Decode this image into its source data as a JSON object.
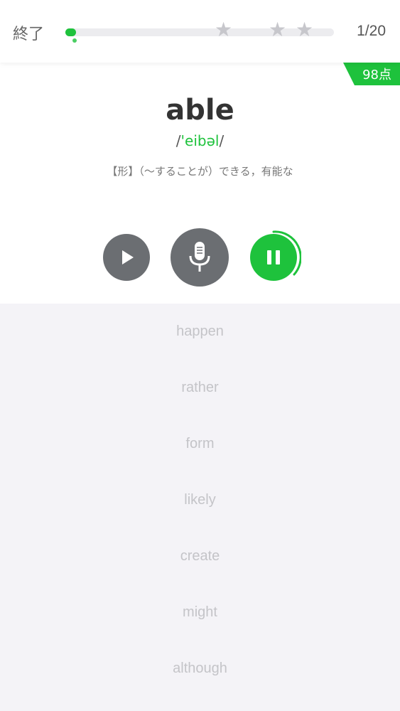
{
  "header": {
    "quit_label": "終了",
    "progress_text": "1/20",
    "progress_fraction": 0.04,
    "star_icon": "star-icon",
    "star_count": 3
  },
  "card": {
    "score": "98点",
    "word": "able",
    "phonetic_prefix": "/",
    "phonetic_core": "'eibəl",
    "phonetic_suffix": "/",
    "meaning": "【形】（～することが）できる，有能な"
  },
  "controls": {
    "play_icon": "play-icon",
    "mic_icon": "microphone-icon",
    "pause_icon": "pause-icon"
  },
  "word_list": [
    "happen",
    "rather",
    "form",
    "likely",
    "create",
    "might",
    "although"
  ],
  "colors": {
    "accent": "#1ec23c",
    "button_gray": "#6b6e72",
    "list_text": "#c4c4c8"
  }
}
